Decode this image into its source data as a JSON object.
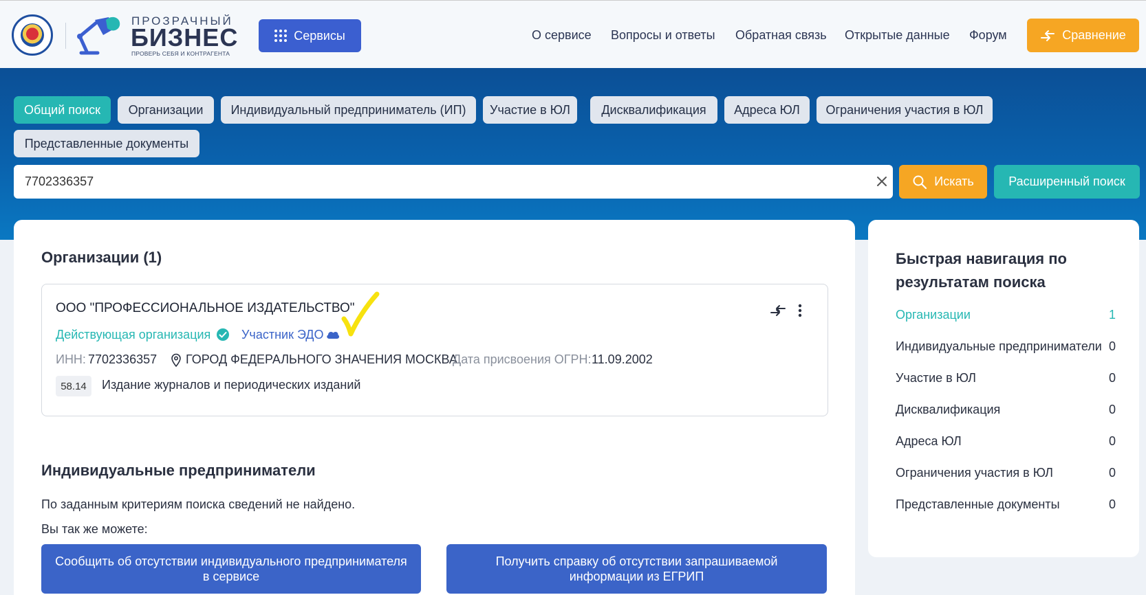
{
  "header": {
    "logo_top": "ПРОЗРАЧНЫЙ",
    "logo_main": "БИЗНЕС",
    "logo_sub": "ПРОВЕРЬ СЕБЯ И КОНТРАГЕНТА",
    "services_label": "Сервисы",
    "nav": [
      "О сервисе",
      "Вопросы и ответы",
      "Обратная связь",
      "Открытые данные",
      "Форум"
    ],
    "compare_label": "Сравнение"
  },
  "tabs": [
    "Общий поиск",
    "Организации",
    "Индивидуальный предприниматель (ИП)",
    "Участие в ЮЛ",
    "Дисквалификация",
    "Адреса ЮЛ",
    "Ограничения участия в ЮЛ",
    "Представленные документы"
  ],
  "active_tab": "Общий поиск",
  "search": {
    "value": "7702336357",
    "search_label": "Искать",
    "advanced_label": "Расширенный поиск"
  },
  "organizations": {
    "heading": "Организации (1)",
    "item": {
      "name": "ООО \"ПРОФЕССИОНАЛЬНОЕ ИЗДАТЕЛЬСТВО\"",
      "status": "Действующая организация",
      "edo": "Участник ЭДО",
      "inn_label": "ИНН:",
      "inn": "7702336357",
      "address": "ГОРОД ФЕДЕРАЛЬНОГО ЗНАЧЕНИЯ МОСКВА",
      "ogrn_date_label": "Дата присвоения ОГРН:",
      "ogrn_date": "11.09.2002",
      "okved_code": "58.14",
      "okved_text": "Издание журналов и периодических изданий"
    }
  },
  "ip": {
    "heading": "Индивидуальные предприниматели",
    "not_found": "По заданным критериям поиска сведений не найдено.",
    "you_can": "Вы так же можете:",
    "btn_report_line1": "Сообщить об отсутствии индивидуального предпринимателя",
    "btn_report_line2": "в сервисе",
    "btn_certificate_line1": "Получить справку об отсутствии запрашиваемой",
    "btn_certificate_line2": "информации из ЕГРИП"
  },
  "quick_nav": {
    "title": "Быстрая навигация по результатам поиска",
    "items": [
      {
        "label": "Организации",
        "count": "1"
      },
      {
        "label": "Индивидуальные предприниматели",
        "count": "0"
      },
      {
        "label": "Участие в ЮЛ",
        "count": "0"
      },
      {
        "label": "Дисквалификация",
        "count": "0"
      },
      {
        "label": "Адреса ЮЛ",
        "count": "0"
      },
      {
        "label": "Ограничения участия в ЮЛ",
        "count": "0"
      },
      {
        "label": "Представленные документы",
        "count": "0"
      }
    ]
  },
  "colors": {
    "teal": "#26b7b3",
    "orange": "#f6a623",
    "blue_button": "#3b64c8",
    "band_blue": "#0a62ad",
    "edo_blue": "#3b64c8",
    "annotation_yellow": "#f7e20f"
  }
}
